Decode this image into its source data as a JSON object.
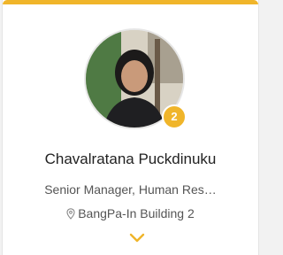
{
  "profile_card": {
    "name": "Chavalratana Puckdinuku",
    "title": "Senior Manager, Human Res…",
    "location": "BangPa-In Building 2",
    "badge_count": "2",
    "location_icon": "map-pin-icon",
    "expand_icon": "chevron-down-icon"
  },
  "colors": {
    "accent": "#f0b52a",
    "text_primary": "#222222",
    "text_secondary": "#555555"
  }
}
